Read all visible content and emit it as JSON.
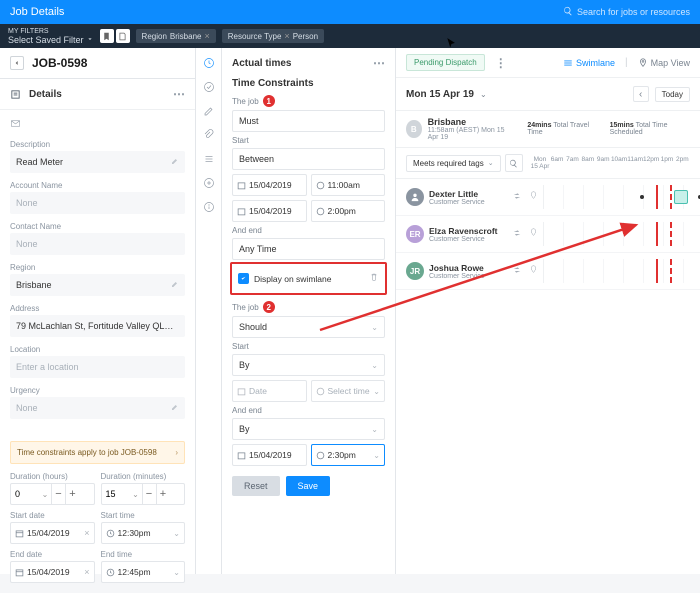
{
  "topbar": {
    "title": "Job Details",
    "search_placeholder": "Search for jobs or resources"
  },
  "filterbar": {
    "my_filters": "MY FILTERS",
    "saved": "Select Saved Filter",
    "pills": [
      {
        "k": "Region",
        "v": "Brisbane"
      },
      {
        "k": "Resource Type",
        "v": "Person"
      }
    ]
  },
  "left": {
    "job_id": "JOB-0598",
    "details": "Details",
    "desc_lbl": "Description",
    "desc": "Read Meter",
    "acct_lbl": "Account Name",
    "acct": "None",
    "cont_lbl": "Contact Name",
    "cont": "None",
    "region_lbl": "Region",
    "region": "Brisbane",
    "addr_lbl": "Address",
    "addr": "79 McLachlan St, Fortitude Valley QLD 400…",
    "loc_lbl": "Location",
    "loc_ph": "Enter a location",
    "urg_lbl": "Urgency",
    "urg": "None",
    "warn": "Time constraints apply to job JOB-0598",
    "dur_h_lbl": "Duration (hours)",
    "dur_h": "0",
    "dur_m_lbl": "Duration (minutes)",
    "dur_m": "15",
    "sd_lbl": "Start date",
    "sd": "15/04/2019",
    "st_lbl": "Start time",
    "st": "12:30pm",
    "ed_lbl": "End date",
    "ed": "15/04/2019",
    "et_lbl": "End time",
    "et": "12:45pm"
  },
  "mid": {
    "actual": "Actual times",
    "tc": "Time Constraints",
    "job_lbl": "The job",
    "must": "Must",
    "start_lbl": "Start",
    "between": "Between",
    "d1": "15/04/2019",
    "t1": "11:00am",
    "d2": "15/04/2019",
    "t2": "2:00pm",
    "end_lbl": "And end",
    "anytime": "Any Time",
    "display": "Display on swimlane",
    "job2_lbl": "The job",
    "should": "Should",
    "start2_lbl": "Start",
    "by": "By",
    "date_ph": "Date",
    "time_ph": "Select time",
    "end2_lbl": "And end",
    "by2": "By",
    "d3": "15/04/2019",
    "t3": "2:30pm",
    "reset": "Reset",
    "save": "Save"
  },
  "right": {
    "pending": "Pending Dispatch",
    "swim": "Swimlane",
    "map": "Map View",
    "date": "Mon 15 Apr 19",
    "today": "Today",
    "loc_badge": "B",
    "loc": "Brisbane",
    "loc_sub": "11:58am (AEST) Mon 15 Apr 19",
    "tt": "24mins",
    "tt_lbl": "Total Travel Time",
    "ts": "15mins",
    "ts_lbl": "Total Time Scheduled",
    "tags": "Meets required tags",
    "hours": [
      "Mon\n15 Apr",
      "6am",
      "7am",
      "8am",
      "9am",
      "10am",
      "11am",
      "12pm",
      "1pm",
      "2pm"
    ],
    "people": [
      {
        "init": "",
        "name": "Dexter Little",
        "role": "Customer Service",
        "bg": "person"
      },
      {
        "init": "ER",
        "name": "Elza Ravenscroft",
        "role": "Customer Service",
        "bg": "#b8a0d8"
      },
      {
        "init": "JR",
        "name": "Joshua Rowe",
        "role": "Customer Service",
        "bg": "#6aa890"
      }
    ]
  }
}
